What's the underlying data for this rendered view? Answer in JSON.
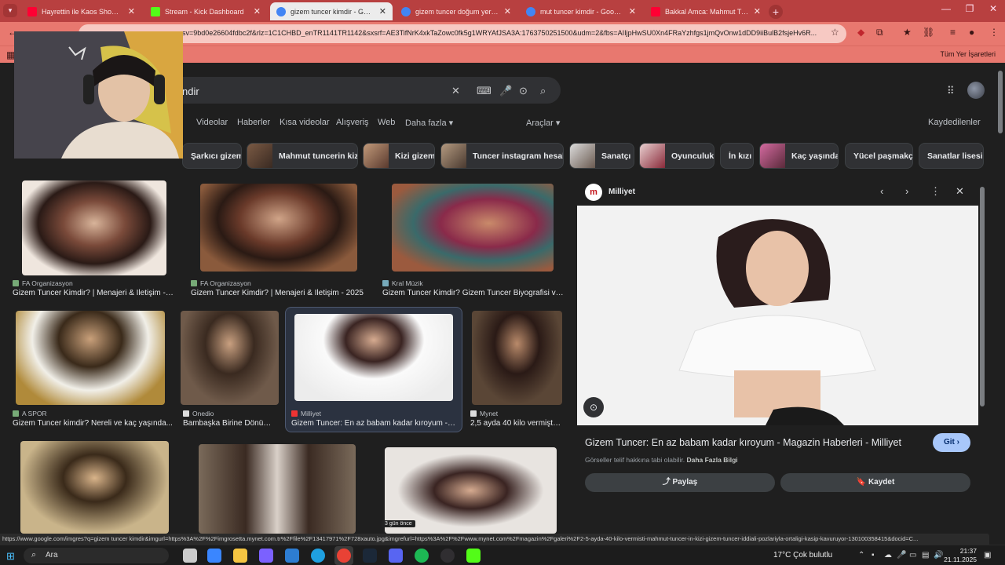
{
  "browser": {
    "tabs": [
      {
        "title": "Hayrettin ile Kaos Show - 2.Se",
        "favicon_color": "#ff0033"
      },
      {
        "title": "Stream - Kick Dashboard",
        "favicon_color": "#53fc18"
      },
      {
        "title": "gizem tuncer kimdir - Google ar",
        "favicon_color": "#4285f4"
      },
      {
        "title": "gizem tuncer doğum yeri - Go",
        "favicon_color": "#4285f4"
      },
      {
        "title": "mut tuncer kimdir - Google ar",
        "favicon_color": "#4285f4"
      },
      {
        "title": "Bakkal Amca: Mahmut Tuncer",
        "favicon_color": "#ff0033"
      }
    ],
    "new_tab": "+",
    "url": "sv=9bd0e26604fdbc2f&rlz=1C1CHBD_enTR1141TR1142&sxsrf=AE3TifNrK4xkTaZowc0fk5g1WRYAfJSA3A:1763750251500&udm=2&fbs=AIIjpHwSU0Xn4FRaYzhfgs1jmQvOnw1dDD9iiBulB2fsjeHv6R...",
    "bookmarks_all": "Tüm Yer İşaretleri",
    "theme_color": "#e8786f"
  },
  "search": {
    "query": "ndir",
    "tabs": [
      "Videolar",
      "Haberler",
      "Kısa videolar",
      "Alışveriş",
      "Web",
      "Daha fazla ▾"
    ],
    "tools": "Araçlar ▾",
    "saved": "Kaydedilenler",
    "chips": [
      {
        "label": "Şarkıcı gizem",
        "has_thumb": false
      },
      {
        "label": "Mahmut tuncerin kizi",
        "has_thumb": true
      },
      {
        "label": "Kizi gizem",
        "has_thumb": true
      },
      {
        "label": "Tuncer instagram hesabı",
        "has_thumb": true
      },
      {
        "label": "Sanatçı",
        "has_thumb": true
      },
      {
        "label": "Oyunculuk",
        "has_thumb": true
      },
      {
        "label": "İn kızı",
        "has_thumb": false
      },
      {
        "label": "Kaç yaşında",
        "has_thumb": true
      },
      {
        "label": "Yücel paşmakçı",
        "has_thumb": false
      },
      {
        "label": "Sanatlar lisesi",
        "has_thumb": false
      }
    ]
  },
  "results": [
    {
      "source": "FA Organizasyon",
      "caption": "Gizem Tuncer Kimdir? | Menajeri & İletişim - 2...",
      "tone": "#efe6de"
    },
    {
      "source": "FA Organizasyon",
      "caption": "Gizem Tuncer Kimdir? | Menajeri & İletişim - 2025",
      "tone": "#8a5a3c"
    },
    {
      "source": "Kral Müzik",
      "caption": "Gizem Tuncer Kimdir? Gizem Tuncer Biyografisi ve ...",
      "tone": "#9b5a3e"
    },
    {
      "source": "A SPOR",
      "caption": "Gizem Tuncer kimdir? Nereli ve kaç yaşında...",
      "tone": "#b08a3a"
    },
    {
      "source": "Onedio",
      "caption": "Bambaşka Birine Dönüş...",
      "tone": "#6f5a4a"
    },
    {
      "source": "Milliyet",
      "caption": "Gizem Tuncer: En az babam kadar kıroyum - ...",
      "tone": "#ececec"
    },
    {
      "source": "Mynet",
      "caption": "2,5 ayda 40 kilo vermiştil...",
      "tone": "#5a4636"
    },
    {
      "source": "",
      "caption": "",
      "tone": "#c9b48a"
    },
    {
      "source": "",
      "caption": "",
      "tone": "#7a6a5a"
    },
    {
      "source": "",
      "caption": "",
      "tone": "#e8e4e0"
    }
  ],
  "time_badge": "3 gün önce",
  "panel": {
    "source": "Milliyet",
    "source_logo": "m",
    "title": "Gizem Tuncer: En az babam kadar kıroyum - Magazin Haberleri - Milliyet",
    "go_label": "Git ›",
    "copyright": "Görseller telif hakkına tabi olabilir.",
    "more_info": "Daha Fazla Bilgi",
    "share_label": "Paylaş",
    "save_label": "Kaydet"
  },
  "status_url": "https://www.google.com/imgres?q=gizem tuncer kimdir&imgurl=https%3A%2F%2Fimgrosetta.mynet.com.tr%2Ffile%2F13417971%2F728xauto.jpg&imgrefurl=https%3A%2F%2Fwww.mynet.com%2Fmagazin%2Fgaleri%2F2-5-ayda-40-kilo-vermisti-mahmut-tuncer-in-kizi-gizem-tuncer-iddiali-pozlariyla-ortaligi-kasip-kavuruyor-130100358415&docid=C...",
  "taskbar": {
    "search_placeholder": "Ara",
    "weather": "17°C  Çok bulutlu",
    "time": "21:37",
    "date": "21.11.2025",
    "apps": [
      {
        "name": "task-view",
        "color": "#cccccc"
      },
      {
        "name": "store",
        "color": "#3a86ff"
      },
      {
        "name": "files",
        "color": "#f5c542"
      },
      {
        "name": "copilot",
        "color": "#7b61ff"
      },
      {
        "name": "mail",
        "color": "#2d7dd2"
      },
      {
        "name": "edge",
        "color": "#1fa0e0"
      },
      {
        "name": "chrome",
        "color": "#e94235"
      },
      {
        "name": "steam",
        "color": "#1b2838"
      },
      {
        "name": "discord",
        "color": "#5865f2"
      },
      {
        "name": "spotify",
        "color": "#1db954"
      },
      {
        "name": "obs",
        "color": "#302e31"
      },
      {
        "name": "kick",
        "color": "#53fc18"
      }
    ]
  }
}
